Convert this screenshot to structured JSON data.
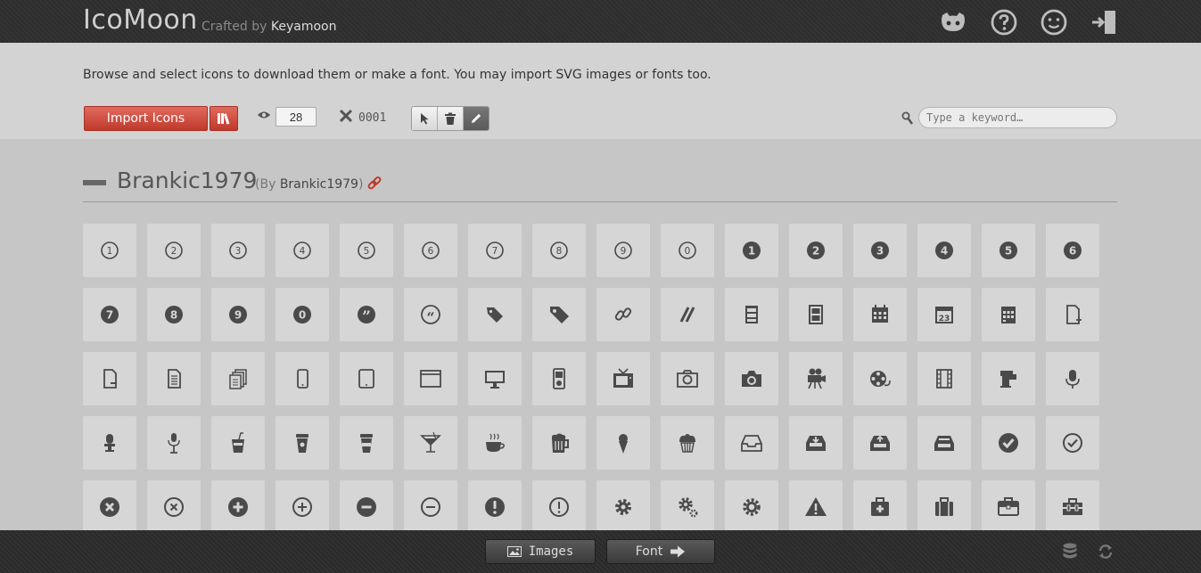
{
  "header": {
    "app_name": "IcoMoon",
    "crafted_prefix": "Crafted by",
    "crafted_author": "Keyamoon",
    "icons": [
      "github-icon",
      "help-icon",
      "smiley-icon",
      "exit-icon"
    ]
  },
  "toolbar": {
    "intro": "Browse and select icons to download them or make a font. You may import SVG images or fonts too.",
    "import_label": "Import Icons",
    "size_value": "28",
    "selected_count": "0001",
    "search_placeholder": "Type a keyword…",
    "modes": [
      "select",
      "delete",
      "edit"
    ],
    "active_mode": "edit"
  },
  "icon_set": {
    "title": "Brankic1979",
    "by_prefix": "(By",
    "by_author": "Brankic1979",
    "by_suffix": ")"
  },
  "icons": [
    [
      "1",
      "2",
      "3",
      "4",
      "5",
      "6",
      "7",
      "8",
      "9",
      "0",
      "1",
      "2",
      "3",
      "4",
      "5",
      "6"
    ],
    [
      "7",
      "8",
      "9",
      "0",
      "quote-right",
      "quote-left",
      "tag",
      "tag-filled",
      "link",
      "slashes",
      "cabinet",
      "cabinet-alt",
      "calendar",
      "calendar-23",
      "calendar-alt",
      "file-add"
    ],
    [
      "file-remove",
      "document",
      "documents",
      "mobile",
      "tablet",
      "browser",
      "monitor",
      "ipod",
      "tv",
      "camera",
      "camera-alt",
      "video-camera",
      "film-reel",
      "film",
      "coffee-machine",
      "microphone"
    ],
    [
      "microphone-alt",
      "microphone-stand",
      "soda",
      "coffee-cup",
      "coffee-cup-alt",
      "cocktail",
      "coffee",
      "beer",
      "ice-cream",
      "cupcake",
      "inbox",
      "inbox-download",
      "inbox-upload",
      "inbox-full",
      "checkmark",
      "checkmark-circle"
    ],
    [
      "close",
      "close-circle",
      "plus",
      "plus-circle",
      "minus",
      "minus-circle",
      "warning",
      "warning-circle",
      "gear",
      "gears",
      "gear-alt",
      "warning-triangle",
      "first-aid",
      "suitcase",
      "briefcase",
      "toolbox"
    ]
  ],
  "footer": {
    "images_label": "Images",
    "font_label": "Font"
  },
  "colors": {
    "accent": "#c0392b",
    "header_bg": "#2e2e2e",
    "icon_fill": "#4a4a4a"
  }
}
